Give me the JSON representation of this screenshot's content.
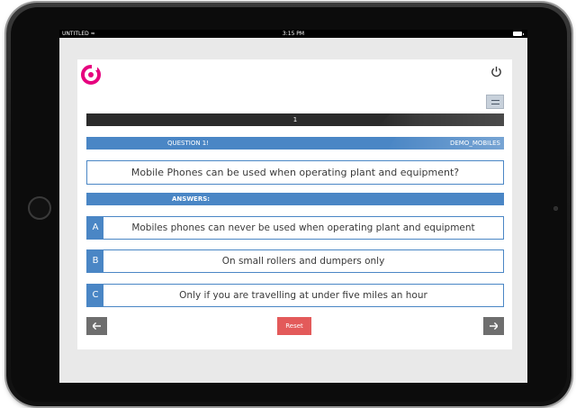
{
  "status_bar": {
    "carrier": "UNTITLED",
    "time": "3:15 PM"
  },
  "header": {
    "logo_icon": "brand-logo-icon",
    "power_icon": "power-icon",
    "menu_icon": "hamburger-menu-icon"
  },
  "progress": {
    "current": "1"
  },
  "question": {
    "label": "QUESTION 1!",
    "code": "DEMO_MOBILES",
    "text": "Mobile Phones can be used when operating plant and equipment?"
  },
  "answers": {
    "label": "ANSWERS:",
    "items": [
      {
        "letter": "A",
        "text": "Mobiles phones can never be used when operating plant and equipment"
      },
      {
        "letter": "B",
        "text": "On small rollers and dumpers only"
      },
      {
        "letter": "C",
        "text": "Only if you are travelling at under five miles an hour"
      }
    ]
  },
  "nav": {
    "reset_label": "Reset",
    "prev_icon": "arrow-left-icon",
    "next_icon": "arrow-right-icon"
  },
  "colors": {
    "accent": "#4a86c5",
    "brand": "#e6007e",
    "reset": "#e35a5a",
    "dark_bar": "#2b2b2b"
  }
}
